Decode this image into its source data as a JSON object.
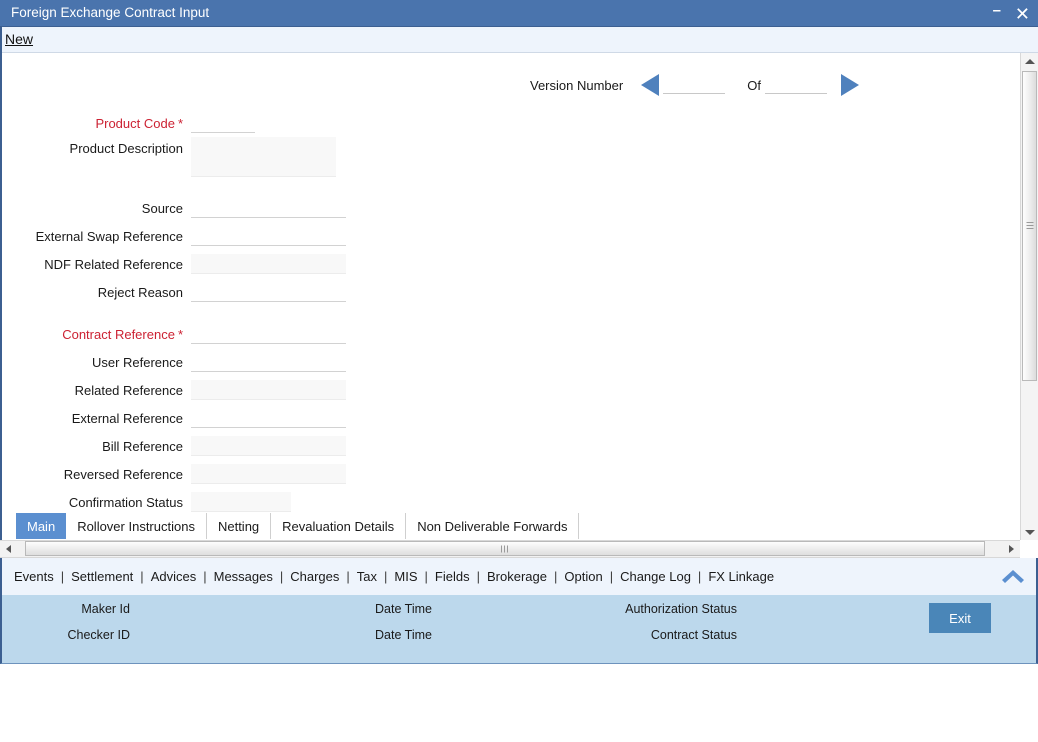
{
  "window": {
    "title": "Foreign Exchange Contract Input",
    "minimize_icon": "minimize-icon",
    "minimize_glyph": "–",
    "close_icon": "close-icon",
    "close_glyph": "✕"
  },
  "actionbar": {
    "new_label": "New"
  },
  "version": {
    "label": "Version Number",
    "prev_icon": "arrow-left-icon",
    "next_icon": "arrow-right-icon",
    "current_value": "",
    "of_label": "Of",
    "total_value": ""
  },
  "form": {
    "fields": [
      {
        "label": "Product Code",
        "required": true,
        "value": "",
        "readonly": false,
        "width": "short"
      },
      {
        "label": "Product Description",
        "required": false,
        "value": "",
        "readonly": true,
        "width": "textarea"
      },
      {
        "label": "Source",
        "required": false,
        "value": "",
        "readonly": false,
        "width": "std"
      },
      {
        "label": "External Swap Reference",
        "required": false,
        "value": "",
        "readonly": false,
        "width": "std"
      },
      {
        "label": "NDF Related Reference",
        "required": false,
        "value": "",
        "readonly": true,
        "width": "std"
      },
      {
        "label": "Reject Reason",
        "required": false,
        "value": "",
        "readonly": false,
        "width": "std"
      },
      {
        "label": "Contract Reference",
        "required": true,
        "value": "",
        "readonly": false,
        "width": "std"
      },
      {
        "label": "User Reference",
        "required": false,
        "value": "",
        "readonly": false,
        "width": "std"
      },
      {
        "label": "Related Reference",
        "required": false,
        "value": "",
        "readonly": true,
        "width": "std"
      },
      {
        "label": "External Reference",
        "required": false,
        "value": "",
        "readonly": false,
        "width": "std"
      },
      {
        "label": "Bill Reference",
        "required": false,
        "value": "",
        "readonly": true,
        "width": "std"
      },
      {
        "label": "Reversed Reference",
        "required": false,
        "value": "",
        "readonly": true,
        "width": "std"
      },
      {
        "label": "Confirmation Status",
        "required": false,
        "value": "",
        "readonly": true,
        "width": "mid"
      }
    ],
    "required_marker": "*"
  },
  "tabs": [
    {
      "label": "Main",
      "active": true
    },
    {
      "label": "Rollover Instructions",
      "active": false
    },
    {
      "label": "Netting",
      "active": false
    },
    {
      "label": "Revaluation Details",
      "active": false
    },
    {
      "label": "Non Deliverable Forwards",
      "active": false
    }
  ],
  "menu": {
    "items": [
      "Events",
      "Settlement",
      "Advices",
      "Messages",
      "Charges",
      "Tax",
      "MIS",
      "Fields",
      "Brokerage",
      "Option",
      "Change Log",
      "FX Linkage"
    ],
    "separator": "|",
    "collapse_icon": "chevron-up-icon"
  },
  "footer": {
    "maker_id_label": "Maker Id",
    "checker_id_label": "Checker ID",
    "date_time_label_1": "Date Time",
    "date_time_label_2": "Date Time",
    "authorization_status_label": "Authorization Status",
    "contract_status_label": "Contract Status",
    "exit_label": "Exit"
  },
  "colors": {
    "titlebar": "#4a74ad",
    "accent_blue": "#4f81bd",
    "tab_active": "#5b8fd0",
    "required_red": "#cc2233",
    "footer_bg": "#bcd8ec",
    "exit_button": "#4a86b8"
  }
}
